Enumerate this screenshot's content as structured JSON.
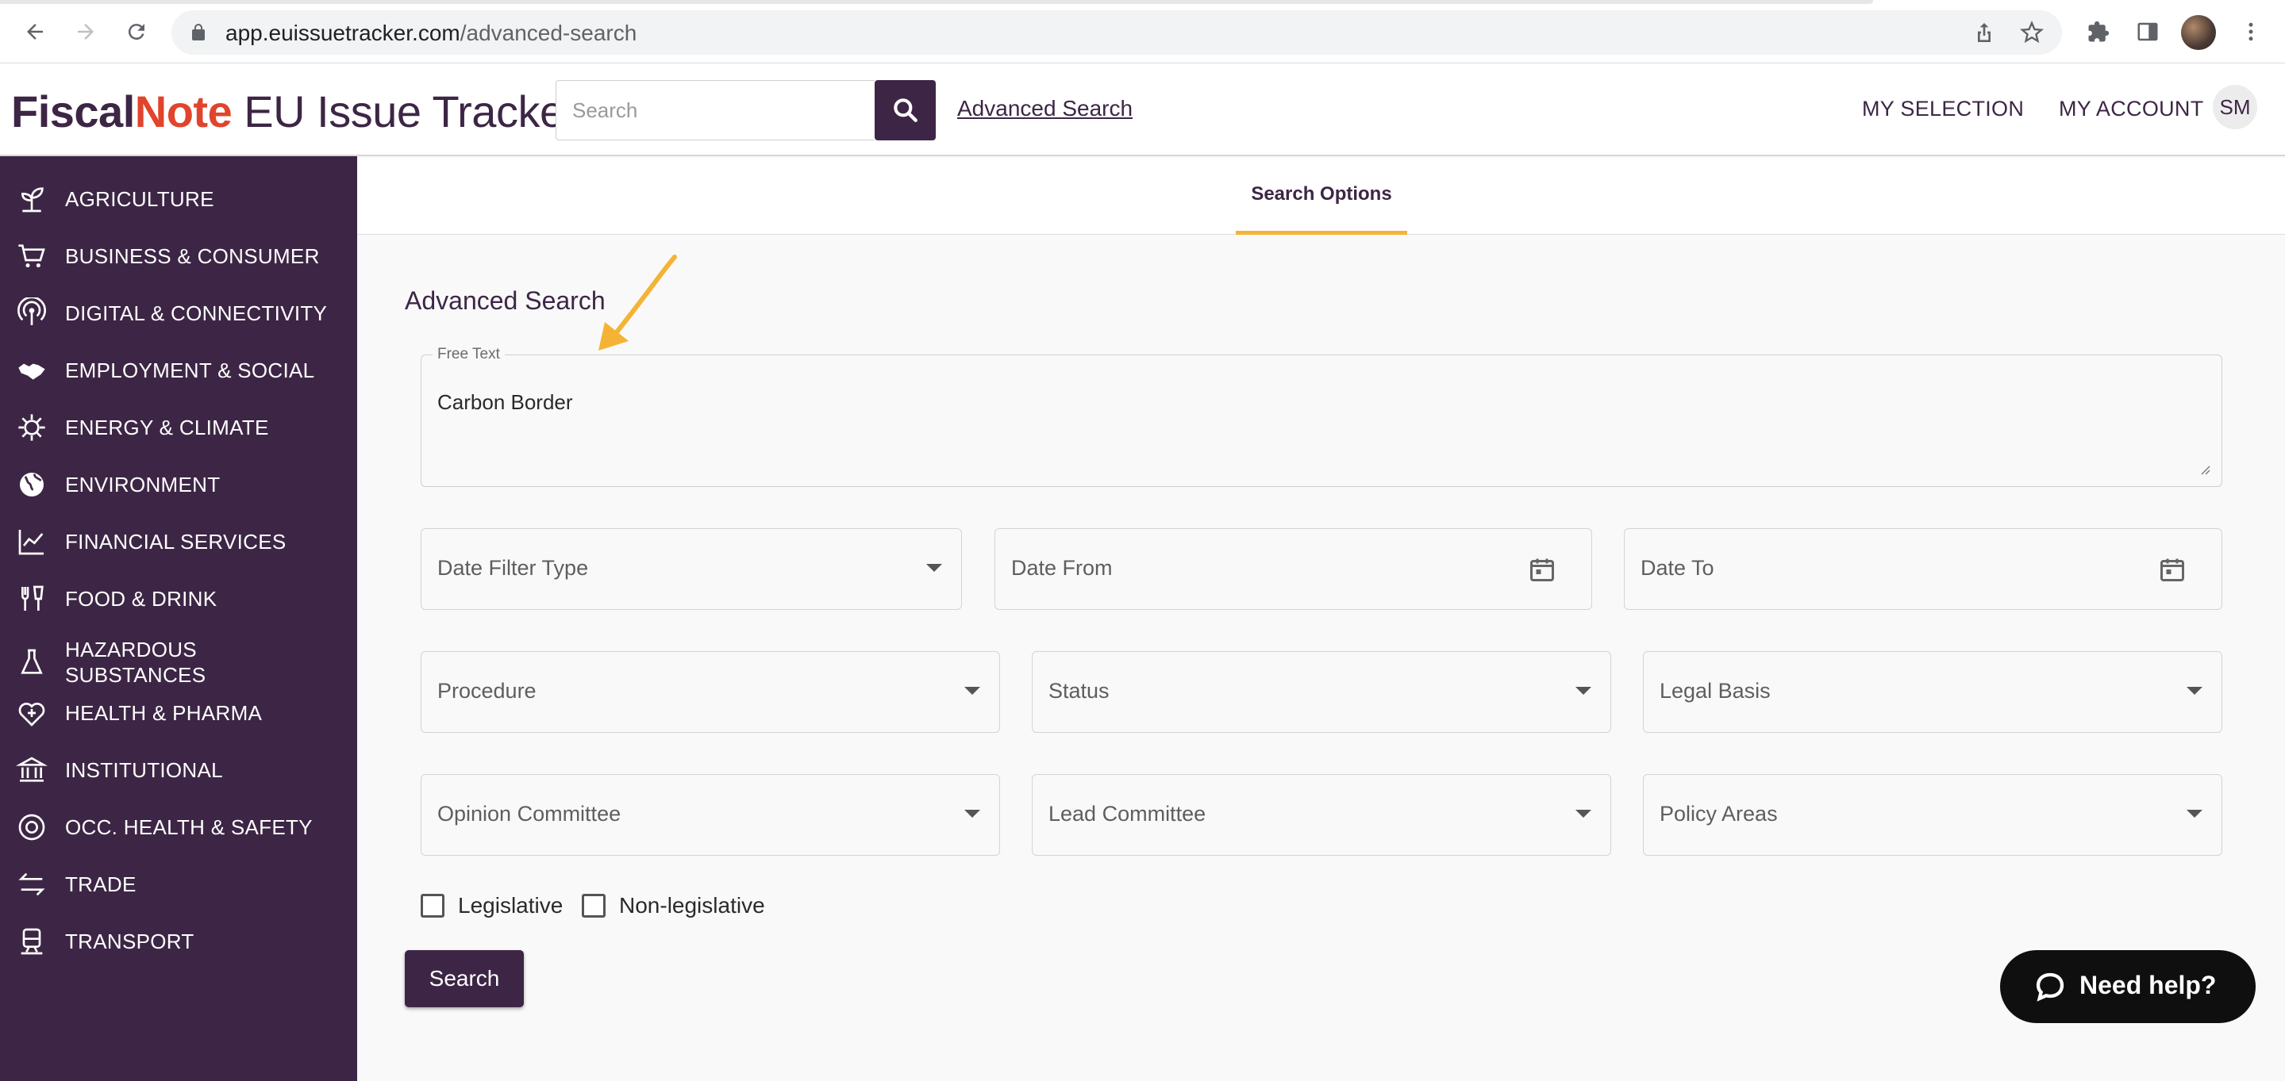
{
  "browser": {
    "url_domain": "app.euissuetracker.com",
    "url_path": "/advanced-search"
  },
  "header": {
    "logo_fiscal": "Fiscal",
    "logo_note": "Note",
    "logo_product": " EU Issue Tracker",
    "search_placeholder": "Search",
    "advanced_search_link": "Advanced Search",
    "my_selection": "MY SELECTION",
    "my_account": "MY ACCOUNT",
    "avatar_initials": "SM"
  },
  "sidebar": {
    "items": [
      {
        "label": "AGRICULTURE",
        "icon": "sprout-icon"
      },
      {
        "label": "BUSINESS & CONSUMER",
        "icon": "cart-icon"
      },
      {
        "label": "DIGITAL & CONNECTIVITY",
        "icon": "antenna-icon"
      },
      {
        "label": "EMPLOYMENT & SOCIAL",
        "icon": "handshake-icon"
      },
      {
        "label": "ENERGY & CLIMATE",
        "icon": "energy-icon"
      },
      {
        "label": "ENVIRONMENT",
        "icon": "globe-icon"
      },
      {
        "label": "FINANCIAL SERVICES",
        "icon": "chart-icon"
      },
      {
        "label": "FOOD & DRINK",
        "icon": "cutlery-icon"
      },
      {
        "label": "HAZARDOUS SUBSTANCES",
        "icon": "flask-icon"
      },
      {
        "label": "HEALTH & PHARMA",
        "icon": "heart-plus-icon"
      },
      {
        "label": "INSTITUTIONAL",
        "icon": "institution-icon"
      },
      {
        "label": "OCC. HEALTH & SAFETY",
        "icon": "lifebuoy-icon"
      },
      {
        "label": "TRADE",
        "icon": "exchange-icon"
      },
      {
        "label": "TRANSPORT",
        "icon": "train-icon"
      }
    ]
  },
  "tabs": {
    "search_options": "Search Options"
  },
  "form": {
    "title": "Advanced Search",
    "free_text_label": "Free Text",
    "free_text_value": "Carbon Border",
    "date_filter_type": "Date Filter Type",
    "date_from": "Date From",
    "date_to": "Date To",
    "procedure": "Procedure",
    "status": "Status",
    "legal_basis": "Legal Basis",
    "opinion_committee": "Opinion Committee",
    "lead_committee": "Lead Committee",
    "policy_areas": "Policy Areas",
    "legislative": "Legislative",
    "non_legislative": "Non-legislative",
    "search_button": "Search"
  },
  "help": {
    "label": "Need help?"
  },
  "colors": {
    "brand_purple": "#3d2645",
    "brand_red": "#e1442c",
    "tab_underline": "#f5b335",
    "annotation_arrow": "#f5b335"
  }
}
